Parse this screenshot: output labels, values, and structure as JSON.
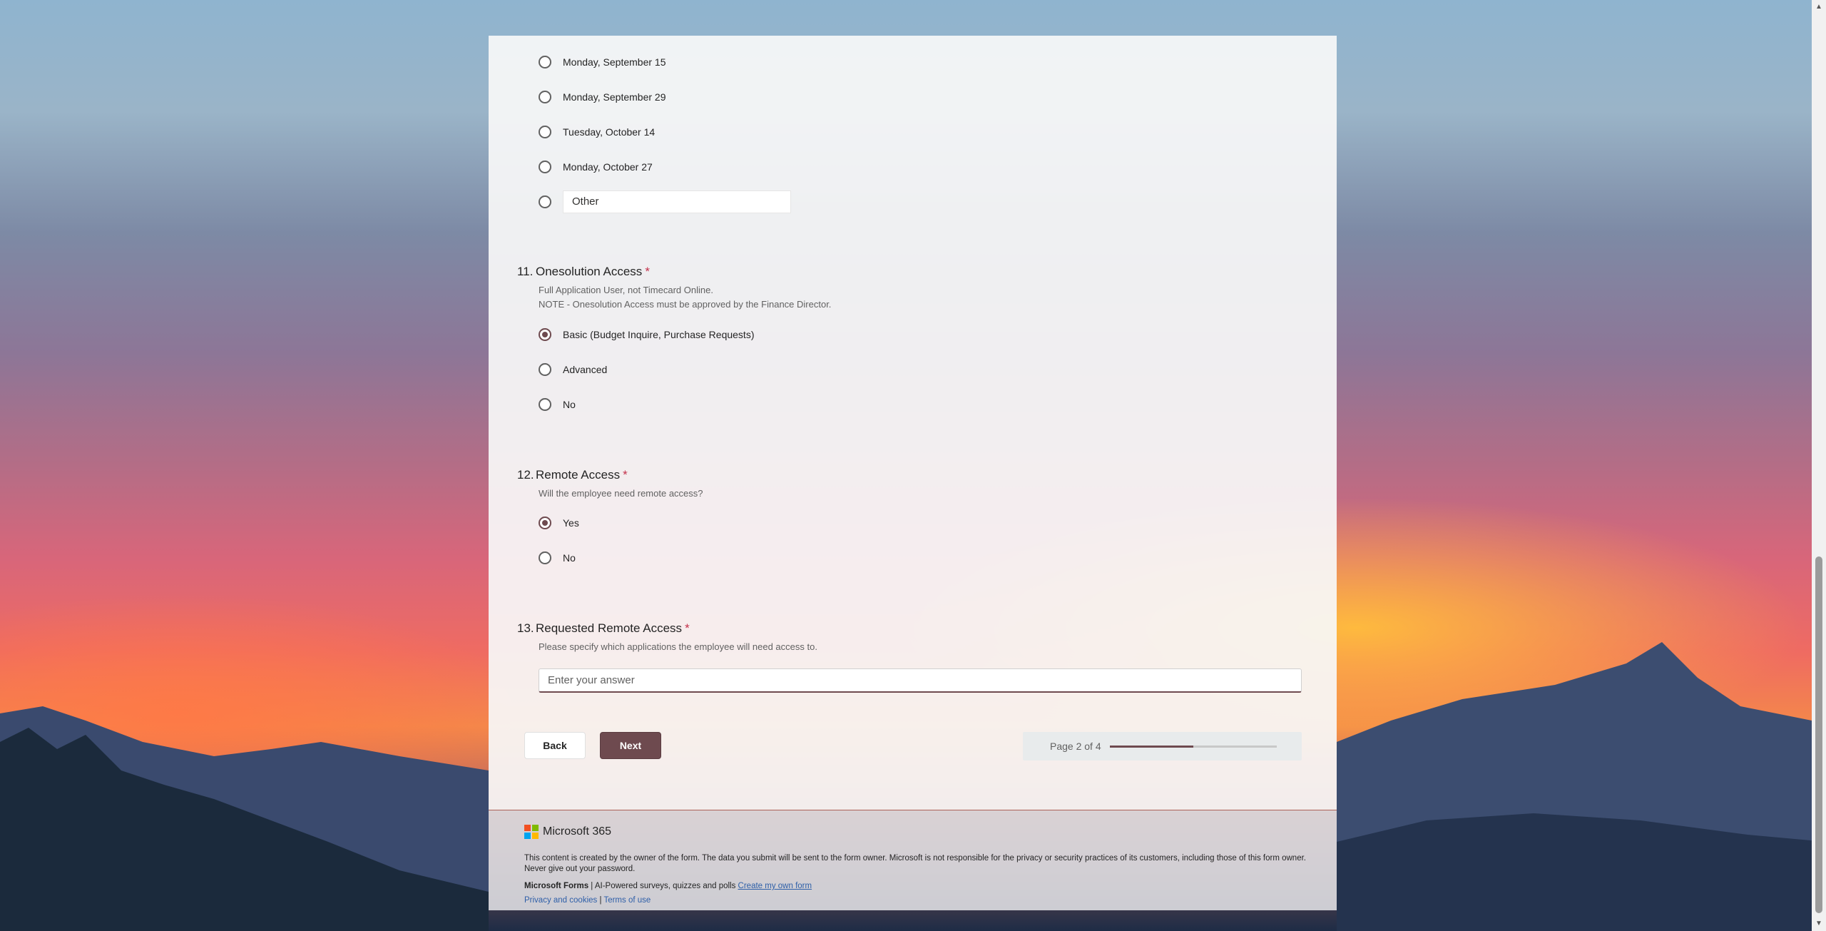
{
  "colors": {
    "accent": "#6e4a4f",
    "required": "#c4314b"
  },
  "q10": {
    "options": [
      "Monday, September 15",
      "Monday, September 29",
      "Tuesday, October 14",
      "Monday, October 27"
    ],
    "other_label": "Other"
  },
  "q11": {
    "number": "11.",
    "title": "Onesolution Access",
    "required_mark": "*",
    "desc_line1": "Full Application User, not Timecard Online.",
    "desc_line2": "NOTE - Onesolution Access must be approved by the Finance Director.",
    "options": [
      "Basic (Budget Inquire, Purchase Requests)",
      "Advanced",
      "No"
    ],
    "selected": "Basic (Budget Inquire, Purchase Requests)"
  },
  "q12": {
    "number": "12.",
    "title": "Remote Access",
    "required_mark": "*",
    "desc": "Will the employee need remote access?",
    "options": [
      "Yes",
      "No"
    ],
    "selected": "Yes"
  },
  "q13": {
    "number": "13.",
    "title": "Requested Remote Access",
    "required_mark": "*",
    "desc": "Please specify which applications the employee will need access to.",
    "placeholder": "Enter your answer",
    "value": ""
  },
  "nav": {
    "back_label": "Back",
    "next_label": "Next",
    "page_text": "Page 2 of 4",
    "progress": 0.5
  },
  "footer": {
    "brand": "Microsoft 365",
    "disclaimer": "This content is created by the owner of the form. The data you submit will be sent to the form owner. Microsoft is not responsible for the privacy or security practices of its customers, including those of this form owner. Never give out your password.",
    "forms_name": "Microsoft Forms",
    "forms_tagline": " | AI-Powered surveys, quizzes and polls ",
    "create_link": "Create my own form",
    "privacy_link": "Privacy and cookies",
    "separator": " | ",
    "terms_link": "Terms of use"
  }
}
